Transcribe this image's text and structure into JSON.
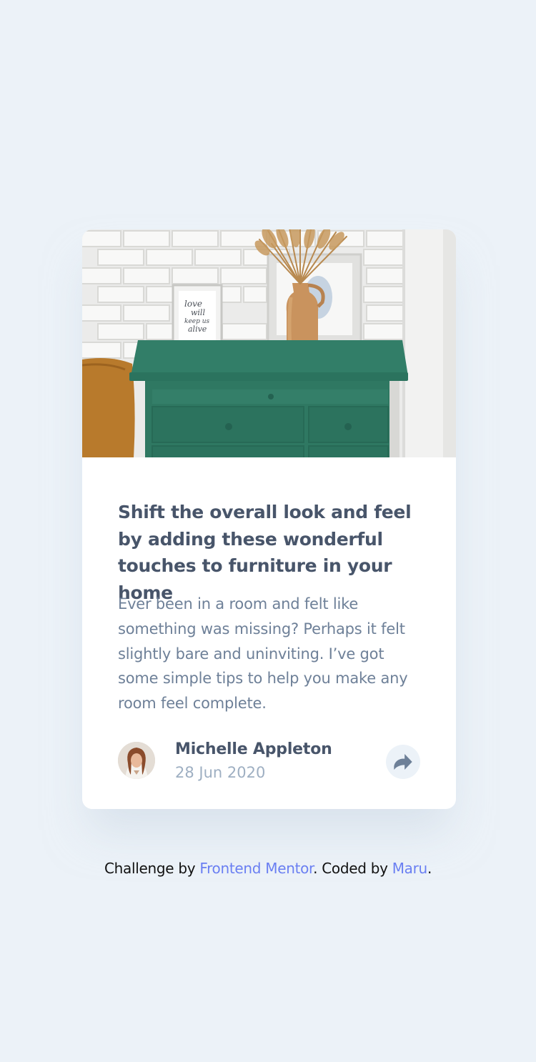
{
  "card": {
    "title": "Shift the overall look and feel by adding these wonderful touches to furniture in your home",
    "description": "Ever been in a room and felt like something was missing? Perhaps it felt slightly bare and uninviting. I’ve got some simple tips to help you make any room feel complete.",
    "hero_frame_text": "love will keep us alive",
    "author": {
      "name": "Michelle Appleton",
      "date": "28 Jun 2020"
    },
    "share_icon": "share-icon"
  },
  "attribution": {
    "prefix": "Challenge by ",
    "challenge_link": "Frontend Mentor",
    "middle": ". Coded by ",
    "author_link": "Maru",
    "suffix": "."
  },
  "colors": {
    "page_background": "#ecf2f8",
    "heading": "#48556a",
    "body_text": "#6e8098",
    "muted": "#9eafc2",
    "link": "#6a7ff2",
    "dresser_green": "#2e7a64"
  }
}
